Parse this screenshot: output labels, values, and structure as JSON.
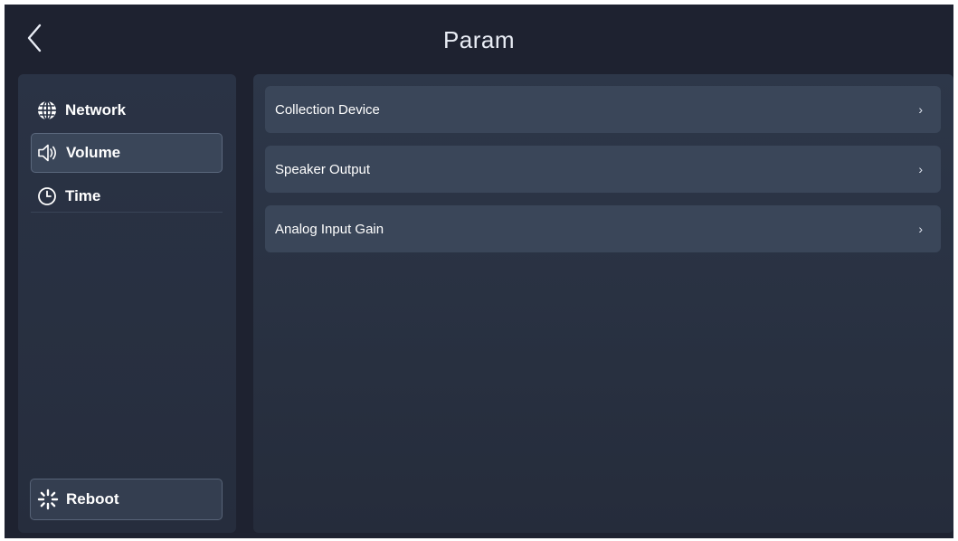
{
  "header": {
    "title": "Param",
    "back_icon": "chevron-left-icon"
  },
  "sidebar": {
    "items": [
      {
        "label": "Network",
        "icon": "globe-icon",
        "active": false
      },
      {
        "label": "Volume",
        "icon": "speaker-icon",
        "active": true
      },
      {
        "label": "Time",
        "icon": "clock-icon",
        "active": false
      }
    ],
    "reboot": {
      "label": "Reboot",
      "icon": "loading-spinner-icon"
    }
  },
  "main": {
    "rows": [
      {
        "label": "Collection Device",
        "chevron": "›"
      },
      {
        "label": "Speaker Output",
        "chevron": "›"
      },
      {
        "label": "Analog Input Gain",
        "chevron": "›"
      }
    ]
  },
  "colors": {
    "background": "#1e2230",
    "panel": "#2a3345",
    "row": "#3a4659",
    "text": "#ffffff"
  }
}
